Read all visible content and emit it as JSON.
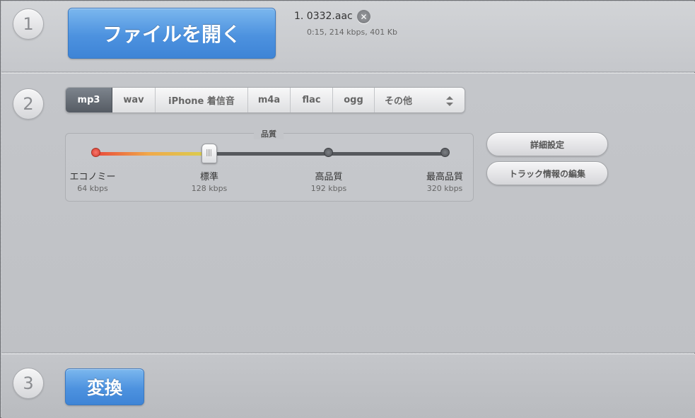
{
  "step1": {
    "number": "1",
    "open_button_label": "ファイルを開く",
    "file": {
      "name": "1. 0332.aac",
      "meta": "0:15, 214 kbps, 401 Kb",
      "remove_icon": "close-circle-icon"
    }
  },
  "step2": {
    "number": "2",
    "formats": [
      {
        "label": "mp3",
        "selected": true
      },
      {
        "label": "wav",
        "selected": false
      },
      {
        "label": "iPhone 着信音",
        "selected": false
      },
      {
        "label": "m4a",
        "selected": false
      },
      {
        "label": "flac",
        "selected": false
      },
      {
        "label": "ogg",
        "selected": false
      },
      {
        "label": "その他",
        "selected": false
      }
    ],
    "quality": {
      "title": "品質",
      "selected_index": 1,
      "levels": [
        {
          "label": "エコノミー",
          "kbps": "64 kbps"
        },
        {
          "label": "標準",
          "kbps": "128 kbps"
        },
        {
          "label": "高品質",
          "kbps": "192 kbps"
        },
        {
          "label": "最高品質",
          "kbps": "320 kbps"
        }
      ]
    },
    "advanced_settings_label": "詳細設定",
    "edit_track_info_label": "トラック情報の編集"
  },
  "step3": {
    "number": "3",
    "convert_button_label": "変換"
  },
  "colors": {
    "accent_blue": "#4d92df",
    "active_tab": "#5d636b",
    "slider_low": "#e94b3b",
    "slider_mid": "#d7d24e"
  }
}
